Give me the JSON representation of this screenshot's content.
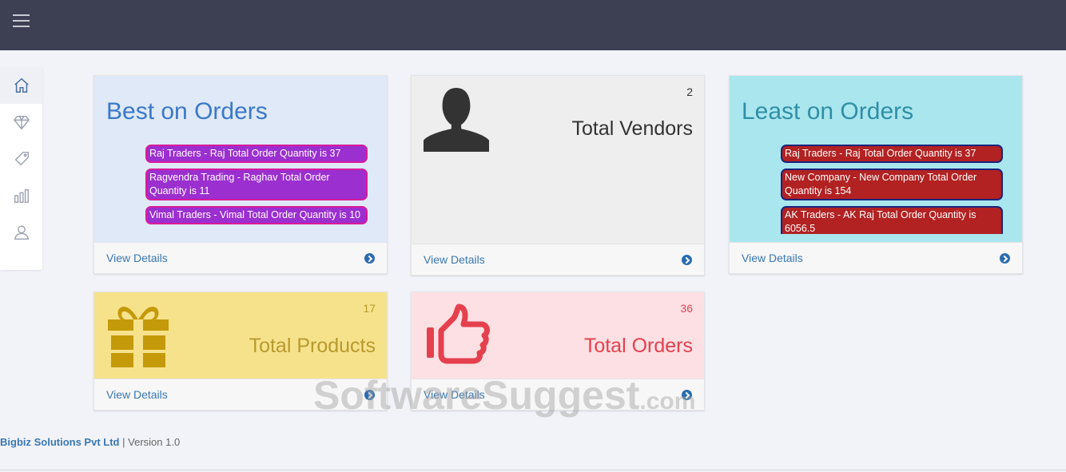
{
  "topbar": {
    "menu_icon": "hamburger-icon"
  },
  "sidebar": {
    "items": [
      {
        "icon": "home-icon"
      },
      {
        "icon": "diamond-icon"
      },
      {
        "icon": "tag-icon"
      },
      {
        "icon": "bar-chart-icon"
      },
      {
        "icon": "user-icon"
      }
    ]
  },
  "best_orders": {
    "title": "Best on Orders",
    "items": [
      "Raj Traders - Raj Total Order Quantity is 37",
      "Ragvendra Trading - Raghav Total Order Quantity is 11",
      "Vimal Traders - Vimal Total Order Quantity is 10"
    ],
    "footer_label": "View Details"
  },
  "vendors": {
    "count": "2",
    "label": "Total Vendors",
    "icon": "user-silhouette-icon",
    "footer_label": "View Details"
  },
  "least_orders": {
    "title": "Least on Orders",
    "items": [
      "Raj Traders - Raj Total Order Quantity is 37",
      "New Company - New Company Total Order Quantity is 154",
      "AK Traders - AK Raj Total Order Quantity is 6056.5"
    ],
    "footer_label": "View Details"
  },
  "products": {
    "count": "17",
    "label": "Total Products",
    "icon": "gift-icon",
    "footer_label": "View Details"
  },
  "orders": {
    "count": "36",
    "label": "Total Orders",
    "icon": "thumbs-up-icon",
    "footer_label": "View Details"
  },
  "footer": {
    "company": "Bigbiz Solutions Pvt Ltd",
    "separator": "|",
    "version": "Version 1.0"
  },
  "watermark": {
    "text": "SoftwareSuggest",
    "suffix": ".com"
  },
  "colors": {
    "topbar": "#3d4052",
    "best_bg": "#dfe9f7",
    "vendors_bg": "#eeeeee",
    "least_bg": "#aae6ee",
    "products_bg": "#f7e28c",
    "orders_bg": "#fde0e3"
  }
}
